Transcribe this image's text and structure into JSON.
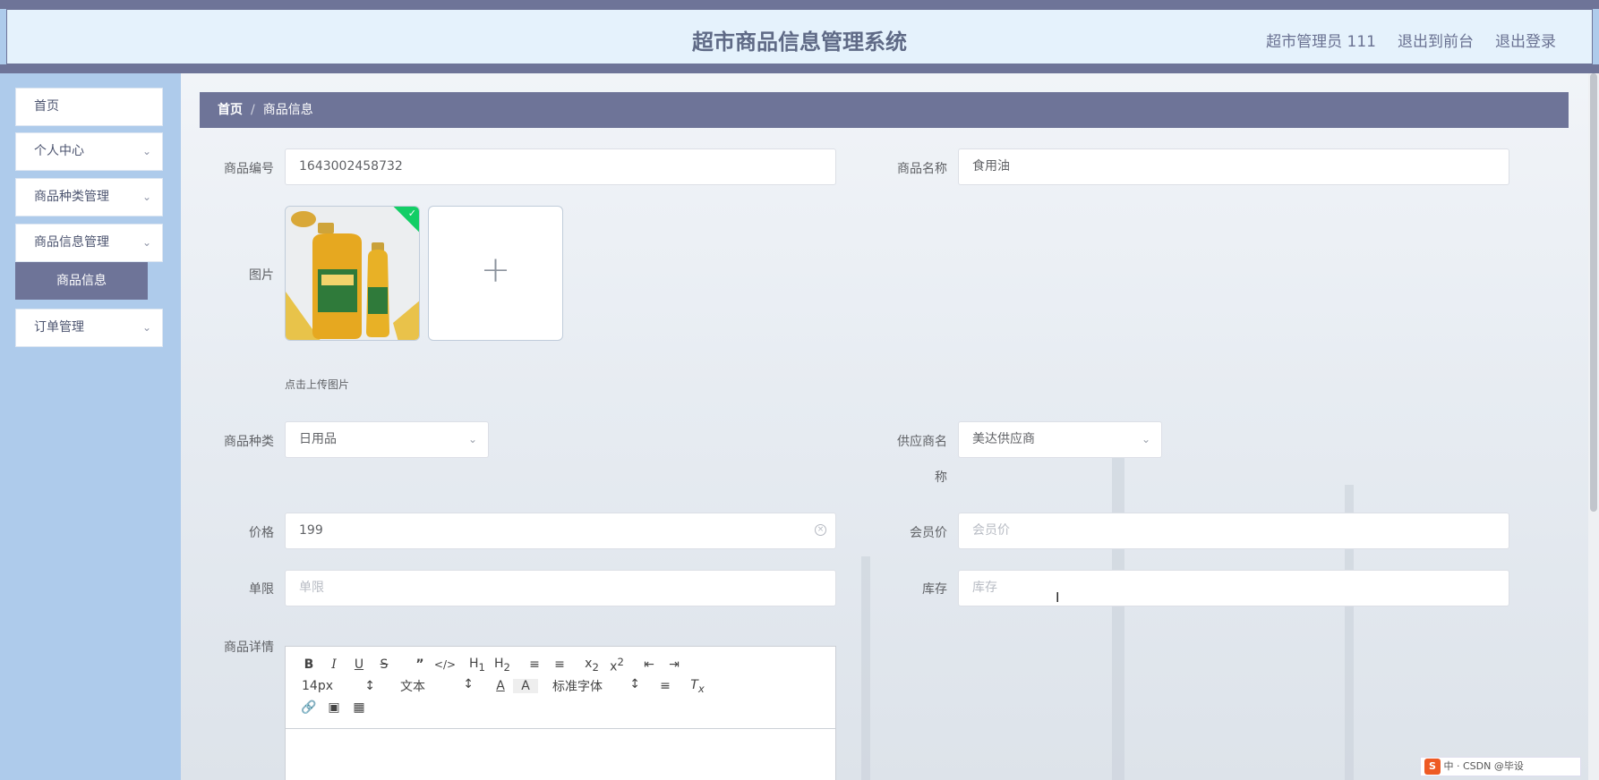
{
  "header": {
    "title": "超市商品信息管理系统",
    "user": "超市管理员 111",
    "back_to_front": "退出到前台",
    "logout": "退出登录"
  },
  "sidebar": {
    "items": [
      {
        "label": "首页",
        "has_arrow": false
      },
      {
        "label": "个人中心",
        "has_arrow": true
      },
      {
        "label": "商品种类管理",
        "has_arrow": true
      },
      {
        "label": "商品信息管理",
        "has_arrow": true
      },
      {
        "label": "订单管理",
        "has_arrow": true
      }
    ],
    "sub_item": "商品信息"
  },
  "breadcrumb": {
    "home": "首页",
    "separator": "/",
    "current": "商品信息"
  },
  "form": {
    "product_no_label": "商品编号",
    "product_no_value": "1643002458732",
    "product_name_label": "商品名称",
    "product_name_value": "食用油",
    "image_label": "图片",
    "upload_hint": "点击上传图片",
    "upload_plus": "+",
    "category_label": "商品种类",
    "category_value": "日用品",
    "supplier_label_1": "供应商名",
    "supplier_label_2": "称",
    "supplier_value": "美达供应商",
    "price_label": "价格",
    "price_value": "199",
    "member_price_label": "会员价",
    "member_price_placeholder": "会员价",
    "limit_label": "单限",
    "limit_placeholder": "单限",
    "stock_label": "库存",
    "stock_placeholder": "库存",
    "detail_label": "商品详情"
  },
  "editor": {
    "font_size": "14px",
    "format": "文本",
    "font_family": "标准字体"
  },
  "ime": {
    "text": "中 · CSDN @毕设"
  },
  "colors": {
    "accent": "#6e7498",
    "sidebar_bg": "#aecbeb",
    "header_bg": "#e5f2fc",
    "success": "#13ce66"
  }
}
